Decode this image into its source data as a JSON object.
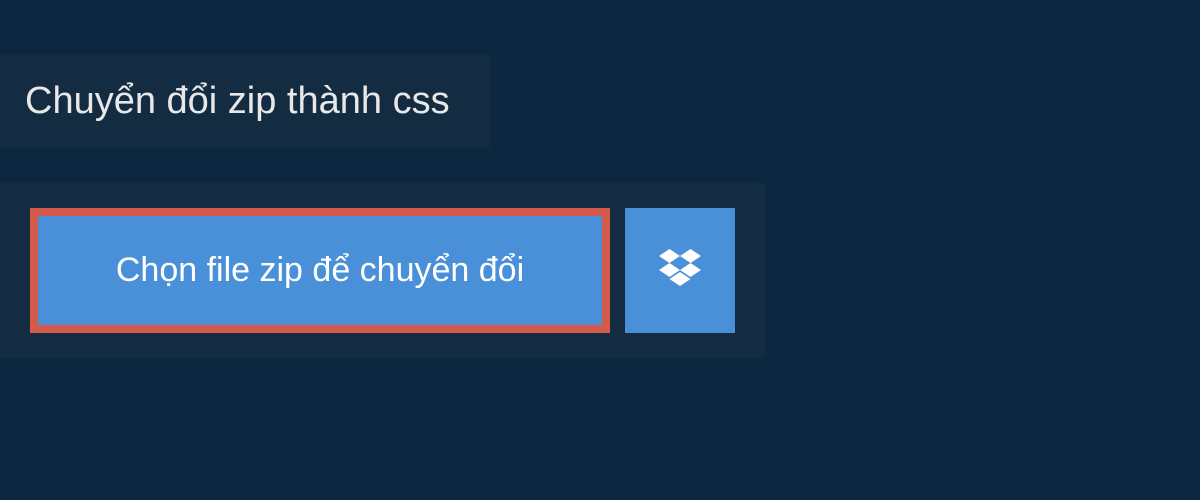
{
  "header": {
    "title": "Chuyển đổi zip thành css"
  },
  "actions": {
    "choose_file_label": "Chọn file zip để chuyển đổi"
  },
  "colors": {
    "background": "#0c2840",
    "panel": "#132c42",
    "button": "#4a90d9",
    "highlight_border": "#d65a4a",
    "text_light": "#e8e8e8",
    "text_white": "#ffffff"
  }
}
